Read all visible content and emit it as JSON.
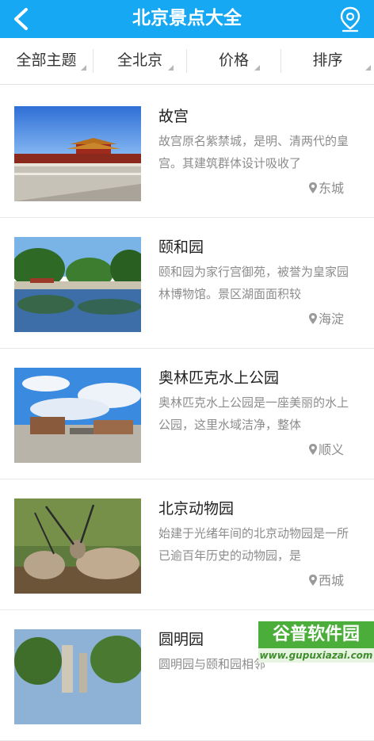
{
  "header": {
    "title": "北京景点大全",
    "back_icon": "chevron-left-icon",
    "location_icon": "location-pin-icon"
  },
  "filters": [
    {
      "label": "全部主题"
    },
    {
      "label": "全北京"
    },
    {
      "label": "价格"
    },
    {
      "label": "排序"
    }
  ],
  "attractions": [
    {
      "name": "故宫",
      "desc": "故宫原名紫禁城，是明、清两代的皇宫。其建筑群体设计吸收了",
      "district": "东城"
    },
    {
      "name": "颐和园",
      "desc": "颐和园为家行宫御苑，被誉为皇家园林博物馆。景区湖面面积较",
      "district": "海淀"
    },
    {
      "name": "奥林匹克水上公园",
      "desc": "奥林匹克水上公园是一座美丽的水上公园，这里水域洁净，整体",
      "district": "顺义"
    },
    {
      "name": "北京动物园",
      "desc": "始建于光绪年间的北京动物园是一所已逾百年历史的动物园，是",
      "district": "西城"
    },
    {
      "name": "圆明园",
      "desc": "圆明园与颐和园相邻",
      "district": ""
    }
  ],
  "watermark": {
    "brand": "谷普软件园",
    "url": "www.gupuxiazai.com"
  },
  "colors": {
    "header_bg": "#16a8f2",
    "text_secondary": "#8c8c8c",
    "watermark_green": "#4cae3a"
  }
}
